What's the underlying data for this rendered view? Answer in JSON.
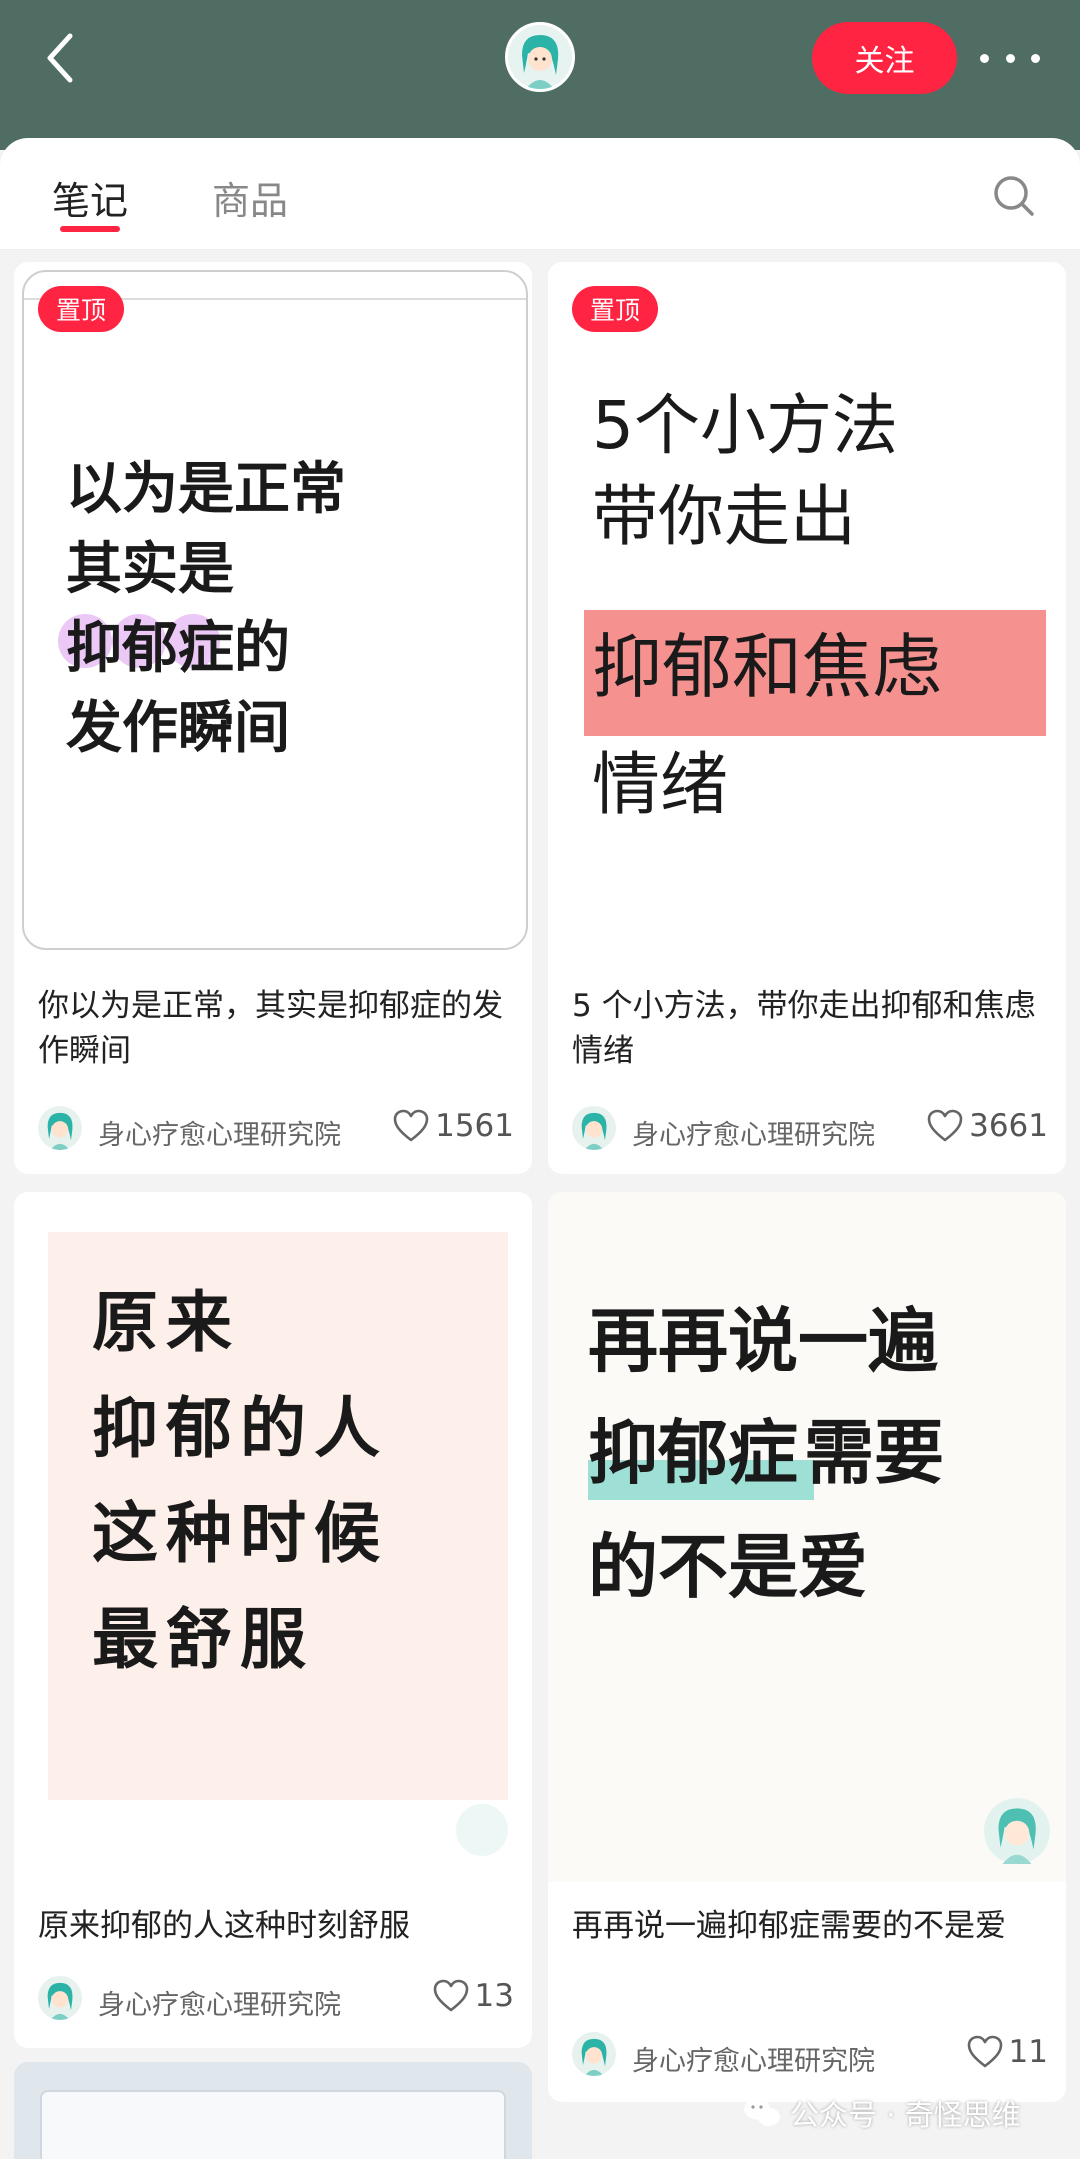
{
  "header": {
    "follow_label": "关注",
    "accent_color": "#ff2442",
    "header_color": "#4f6d63"
  },
  "tabs": {
    "notes": "笔记",
    "goods": "商品"
  },
  "cards": [
    {
      "pin_label": "置顶",
      "cover_lines": "以为是正常\n其实是\n抑郁症的\n发作瞬间",
      "title": "你以为是正常，其实是抑郁症的发作瞬间",
      "author": "身心疗愈心理研究院",
      "likes": "1561"
    },
    {
      "pin_label": "置顶",
      "cover_lines_top": "5个小方法\n带你走出",
      "cover_line_highlight": "抑郁和焦虑",
      "cover_line_bottom": "情绪",
      "title": "5 个小方法，带你走出抑郁和焦虑情绪",
      "author": "身心疗愈心理研究院",
      "likes": "3661"
    },
    {
      "cover_lines": "原来\n抑郁的人\n这种时候\n最舒服",
      "title": "原来抑郁的人这种时刻舒服",
      "author": "身心疗愈心理研究院",
      "likes": "13"
    },
    {
      "cover_line1": "再再说一遍",
      "cover_highlight": "抑郁症",
      "cover_line2_rest": "需要",
      "cover_line3": "的不是爱",
      "title": "再再说一遍抑郁症需要的不是爱",
      "author": "身心疗愈心理研究院",
      "likes": "11"
    }
  ],
  "watermark": {
    "text": "公众号 · 奇怪思维"
  },
  "icons": [
    "back-icon",
    "avatar",
    "more-icon",
    "search-icon",
    "heart-icon",
    "wechat-icon"
  ]
}
